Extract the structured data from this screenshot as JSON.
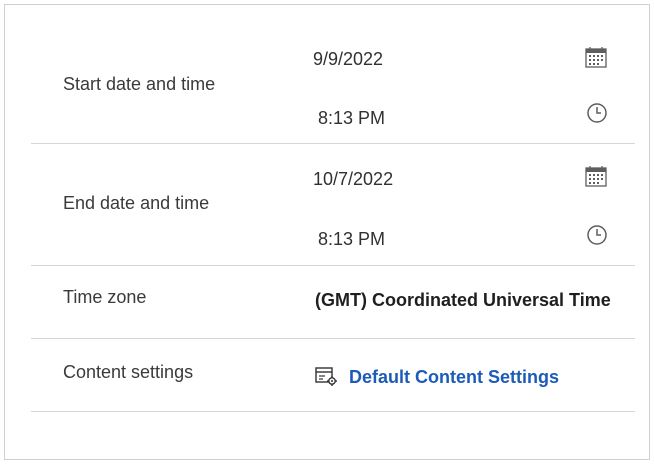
{
  "fields": {
    "start": {
      "label": "Start date and time",
      "date": "9/9/2022",
      "time": "8:13 PM",
      "date_icon": "calendar-icon",
      "time_icon": "clock-icon"
    },
    "end": {
      "label": "End date and time",
      "date": "10/7/2022",
      "time": "8:13 PM",
      "date_icon": "calendar-icon",
      "time_icon": "clock-icon"
    },
    "time_zone": {
      "label": "Time zone",
      "value": "(GMT) Coordinated Universal Time"
    },
    "content_settings": {
      "label": "Content settings",
      "link": "Default Content Settings",
      "icon": "settings-form-icon"
    }
  },
  "colors": {
    "link": "#1d5bb8",
    "divider": "#d6d6d6",
    "icon": "#605e5c"
  }
}
